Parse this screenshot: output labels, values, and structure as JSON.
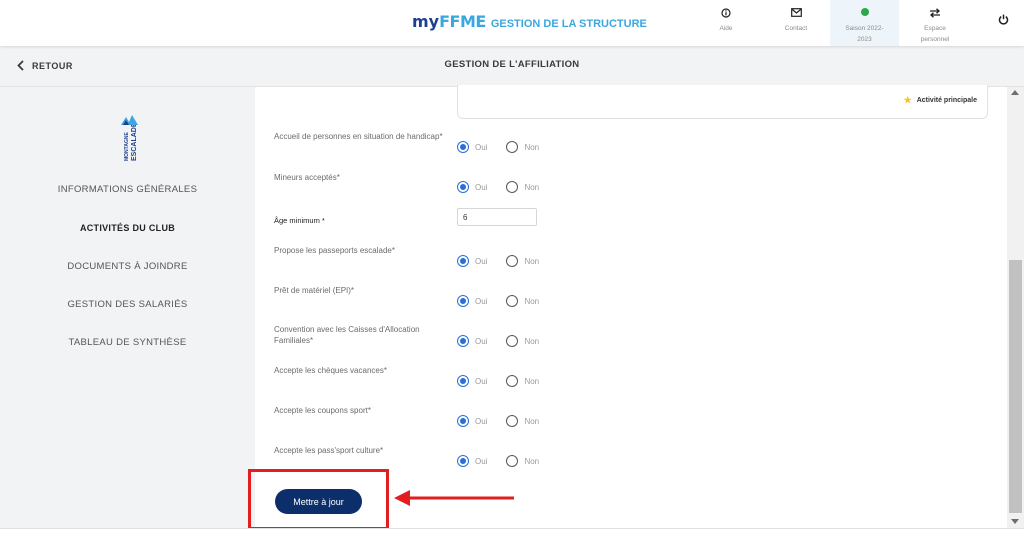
{
  "header": {
    "brand_my": "my",
    "brand_ffme": "FFME",
    "brand_title": "GESTION DE LA STRUCTURE",
    "items": [
      {
        "label": "Aide",
        "icon": "info-icon"
      },
      {
        "label": "Contact",
        "icon": "mail-icon"
      },
      {
        "label": "Saison 2022-2023",
        "icon": "season-status-dot-icon",
        "status_color": "#2ba84a"
      },
      {
        "label": "Espace personnel",
        "icon": "swap-arrows-icon"
      },
      {
        "label": "",
        "icon": "power-icon"
      }
    ]
  },
  "subheader": {
    "back_label": "RETOUR",
    "title": "GESTION DE L'AFFILIATION"
  },
  "sidebar": {
    "logo_alt": "MONTAGNE ESCALADE",
    "items": [
      {
        "label": "INFORMATIONS GÉNÉRALES",
        "active": false
      },
      {
        "label": "ACTIVITÉS DU CLUB",
        "active": true
      },
      {
        "label": "DOCUMENTS À JOINDRE",
        "active": false
      },
      {
        "label": "GESTION DES SALARIÉS",
        "active": false
      },
      {
        "label": "TABLEAU DE SYNTHÈSE",
        "active": false
      }
    ]
  },
  "main": {
    "activity_card": {
      "principal_label": "Activité principale"
    },
    "questions": [
      {
        "label": "Accueil de personnes en situation de handicap*",
        "value": "Oui"
      },
      {
        "label": "Mineurs acceptés*",
        "value": "Oui"
      },
      {
        "label": "Propose les passeports escalade*",
        "value": "Oui"
      },
      {
        "label": "Prêt de matériel (EPI)*",
        "value": "Oui"
      },
      {
        "label": "Convention avec les Caisses d'Allocation Familiales*",
        "value": "Oui"
      },
      {
        "label": "Accepte les chèques vacances*",
        "value": "Oui"
      },
      {
        "label": "Accepte les coupons sport*",
        "value": "Oui"
      },
      {
        "label": "Accepte les pass'sport culture*",
        "value": "Oui"
      }
    ],
    "option_yes": "Oui",
    "option_no": "Non",
    "age_min": {
      "label": "Âge minimum *",
      "value": "6"
    },
    "update_button": "Mettre à jour"
  },
  "annotation": {
    "color": "#e31e1e"
  },
  "colors": {
    "brand_dark": "#1f3f8f",
    "brand_light": "#3aa7e0",
    "button": "#0c2f6b",
    "radio_selected": "#2a6fd6"
  }
}
